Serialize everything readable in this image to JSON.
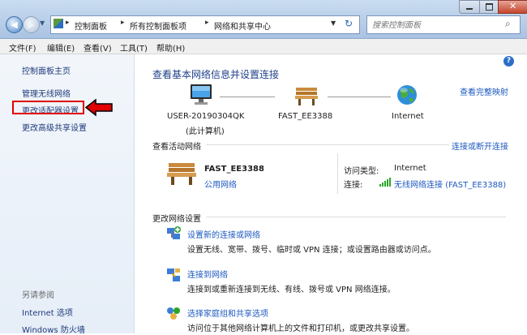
{
  "window": {
    "address": {
      "crumbs": [
        "控制面板",
        "所有控制面板项",
        "网络和共享中心"
      ]
    },
    "search_placeholder": "搜索控制面板"
  },
  "menu": [
    "文件(F)",
    "编辑(E)",
    "查看(V)",
    "工具(T)",
    "帮助(H)"
  ],
  "sidebar": {
    "home": "控制面板主页",
    "items": [
      "管理无线网络",
      "更改适配器设置",
      "更改高级共享设置"
    ],
    "see_also_label": "另请参阅",
    "see_also": [
      "Internet 选项",
      "Windows 防火墙"
    ]
  },
  "main": {
    "title": "查看基本网络信息并设置连接",
    "view_full_map": "查看完整映射",
    "map": {
      "computer_name": "USER-20190304QK",
      "computer_sub": "(此计算机)",
      "network_name": "FAST_EE3388",
      "internet": "Internet"
    },
    "active_section": {
      "title": "查看活动网络",
      "connect_link": "连接或断开连接",
      "network_name": "FAST_EE3388",
      "network_type": "公用网络",
      "access_type_label": "访问类型:",
      "access_type_value": "Internet",
      "connection_label": "连接:",
      "connection_value": "无线网络连接 (FAST_EE3388)"
    },
    "change_section": {
      "title": "更改网络设置",
      "tasks": [
        {
          "title": "设置新的连接或网络",
          "desc": "设置无线、宽带、拨号、临时或 VPN 连接；或设置路由器或访问点。"
        },
        {
          "title": "连接到网络",
          "desc": "连接到或重新连接到无线、有线、拨号或 VPN 网络连接。"
        },
        {
          "title": "选择家庭组和共享选项",
          "desc": "访问位于其他网络计算机上的文件和打印机，或更改共享设置。"
        }
      ]
    }
  },
  "colors": {
    "link": "#1c59c0",
    "annotation": "#e00000",
    "sidebar_bg": "#e6eef8"
  }
}
